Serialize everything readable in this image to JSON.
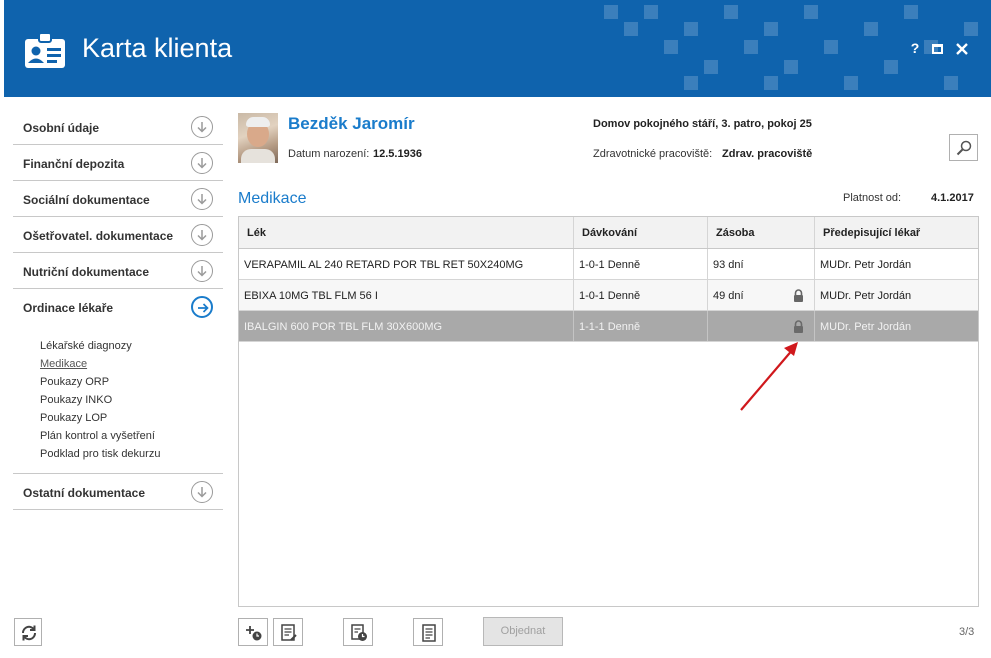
{
  "window": {
    "title": "Karta klienta",
    "help_label": "?"
  },
  "sidebar": {
    "items": [
      {
        "label": "Osobní údaje"
      },
      {
        "label": "Finanční depozita"
      },
      {
        "label": "Sociální dokumentace"
      },
      {
        "label": "Ošetřovatel. dokumentace"
      },
      {
        "label": "Nutriční dokumentace"
      },
      {
        "label": "Ordinace lékaře"
      },
      {
        "label": "Ostatní dokumentace"
      }
    ],
    "active_index": 5,
    "sub_items": [
      {
        "label": "Lékařské diagnozy"
      },
      {
        "label": "Medikace"
      },
      {
        "label": "Poukazy ORP"
      },
      {
        "label": "Poukazy INKO"
      },
      {
        "label": "Poukazy LOP"
      },
      {
        "label": "Plán kontrol a vyšetření"
      },
      {
        "label": "Podklad pro tisk dekurzu"
      }
    ],
    "active_sub_index": 1
  },
  "patient": {
    "name": "Bezděk Jaromír",
    "dob_label": "Datum narození:",
    "dob": "12.5.1936",
    "residence": "Domov pokojného stáří, 3. patro, pokoj 25",
    "workplace_label": "Zdravotnické pracoviště:",
    "workplace": "Zdrav. pracoviště"
  },
  "section": {
    "title": "Medikace",
    "valid_label": "Platnost od:",
    "valid_from": "4.1.2017"
  },
  "table": {
    "headers": [
      "Lék",
      "Dávkování",
      "Zásoba",
      "Předepisující lékař"
    ],
    "rows": [
      {
        "drug": "VERAPAMIL AL 240 RETARD POR TBL RET 50X240MG",
        "dosage": "1-0-1 Denně",
        "stock": "93 dní",
        "doctor": "MUDr. Petr Jordán",
        "locked": false
      },
      {
        "drug": "EBIXA 10MG TBL FLM 56 I",
        "dosage": "1-0-1 Denně",
        "stock": "49 dní",
        "doctor": "MUDr. Petr Jordán",
        "locked": true
      },
      {
        "drug": "IBALGIN 600 POR TBL FLM 30X600MG",
        "dosage": "1-1-1 Denně",
        "stock": "",
        "doctor": "MUDr. Petr Jordán",
        "locked": true
      }
    ],
    "selected_row": 2
  },
  "toolbar": {
    "order_label": "Objednat",
    "page_indicator": "3/3"
  },
  "colors": {
    "titlebar": "#0f63ad",
    "accent": "#1a7ccb",
    "selected_row": "#a9a9a9",
    "annotation_arrow": "#d0181c"
  }
}
